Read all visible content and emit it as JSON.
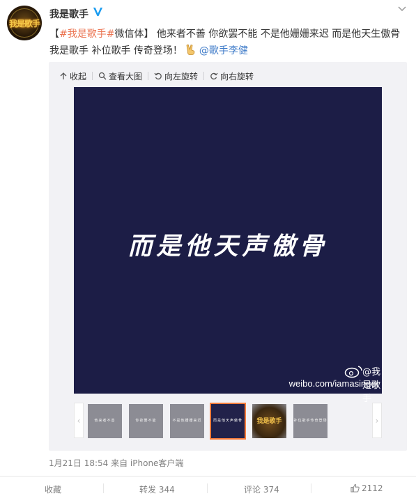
{
  "post": {
    "username": "我是歌手",
    "avatar_label": "我是歌手",
    "text_parts": {
      "bracket_open": "【",
      "hashtag1": "#我是歌手#",
      "hashtag1_suffix": "微信体",
      "bracket_close": "】",
      "body": "他来者不善 你欲罢不能 不是他姗姗来迟 而是他天生傲骨 我是歌手 补位歌手 传奇登场！",
      "mention": "@歌手李健"
    }
  },
  "toolbar": {
    "collapse_label": "收起",
    "view_large_label": "查看大图",
    "rotate_left_label": "向左旋转",
    "rotate_right_label": "向右旋转"
  },
  "image": {
    "caption": "而是他天声傲骨",
    "watermark_handle": "@我是歌手",
    "watermark_url": "weibo.com/iamasinger",
    "background": "#1c1d46"
  },
  "thumbnails": [
    {
      "caption": "他来者不善",
      "style": "gray"
    },
    {
      "caption": "你欲罢不能",
      "style": "gray"
    },
    {
      "caption": "不是他姗姗来迟",
      "style": "gray"
    },
    {
      "caption": "而是他天声傲骨",
      "style": "dark-selected"
    },
    {
      "caption": "我是歌手",
      "style": "logo"
    },
    {
      "caption": "补位歌手传奇登场",
      "style": "gray"
    }
  ],
  "timestamp": "1月21日 18:54 来自 iPhone客户端",
  "footer": {
    "favorite_label": "收藏",
    "repost_label": "转发 344",
    "comment_label": "评论 374",
    "like_count": "2112"
  },
  "colors": {
    "accent_orange": "#eb7350",
    "mention_blue": "#3d7ac8",
    "selected_border": "#fa7d3c",
    "verified_blue": "#1a9cf0"
  }
}
